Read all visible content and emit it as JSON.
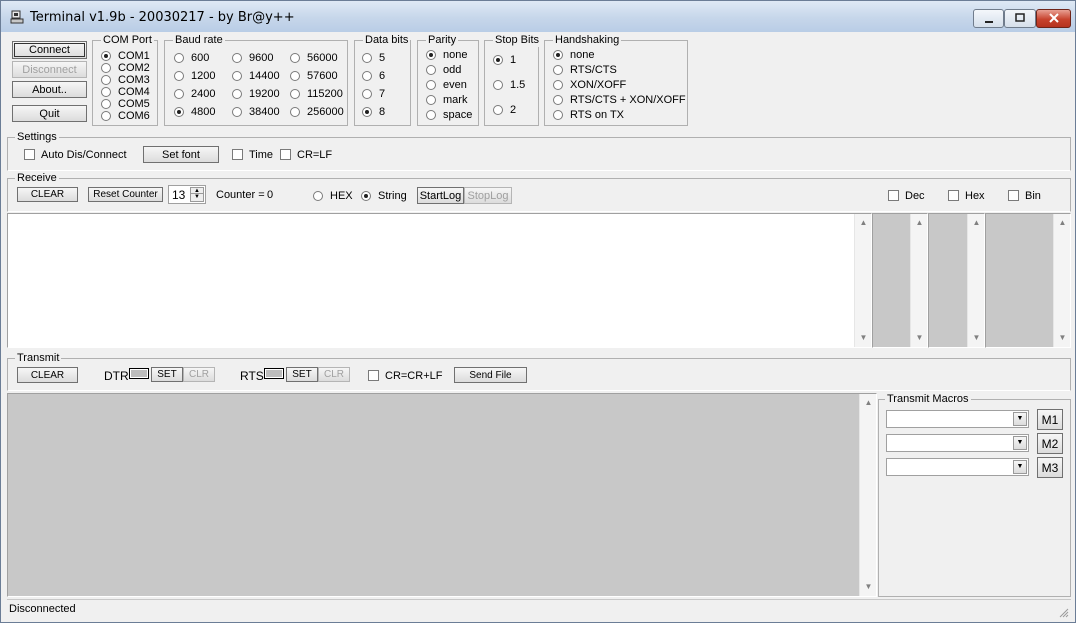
{
  "window": {
    "title": "Terminal v1.9b - 20030217 - by Br@y++"
  },
  "main_buttons": {
    "connect": "Connect",
    "disconnect": "Disconnect",
    "about": "About..",
    "quit": "Quit"
  },
  "com_port": {
    "title": "COM Port",
    "options": [
      "COM1",
      "COM2",
      "COM3",
      "COM4",
      "COM5",
      "COM6"
    ],
    "selected": "COM1"
  },
  "baud_rate": {
    "title": "Baud rate",
    "options": [
      "600",
      "1200",
      "2400",
      "4800",
      "9600",
      "14400",
      "19200",
      "38400",
      "56000",
      "57600",
      "115200",
      "256000"
    ],
    "selected": "4800"
  },
  "data_bits": {
    "title": "Data bits",
    "options": [
      "5",
      "6",
      "7",
      "8"
    ],
    "selected": "8"
  },
  "parity": {
    "title": "Parity",
    "options": [
      "none",
      "odd",
      "even",
      "mark",
      "space"
    ],
    "selected": "none"
  },
  "stop_bits": {
    "title": "Stop Bits",
    "options": [
      "1",
      "1.5",
      "2"
    ],
    "selected": "1"
  },
  "handshaking": {
    "title": "Handshaking",
    "options": [
      "none",
      "RTS/CTS",
      "XON/XOFF",
      "RTS/CTS + XON/XOFF",
      "RTS on TX"
    ],
    "selected": "none"
  },
  "settings": {
    "title": "Settings",
    "auto_dis_connect": "Auto Dis/Connect",
    "set_font": "Set font",
    "time": "Time",
    "cr_lf": "CR=LF"
  },
  "receive": {
    "title": "Receive",
    "clear": "CLEAR",
    "reset_counter": "Reset Counter",
    "counter_spin_value": "13",
    "counter_label": "Counter =",
    "counter_value": "0",
    "hex": "HEX",
    "string": "String",
    "mode_selected": "String",
    "start_log": "StartLog",
    "stop_log": "StopLog",
    "dec": "Dec",
    "hex_check": "Hex",
    "bin": "Bin"
  },
  "transmit": {
    "title": "Transmit",
    "clear": "CLEAR",
    "dtr": "DTR",
    "rts": "RTS",
    "set": "SET",
    "clr": "CLR",
    "cr_crlf": "CR=CR+LF",
    "send_file": "Send File"
  },
  "macros": {
    "title": "Transmit Macros",
    "buttons": [
      "M1",
      "M2",
      "M3"
    ]
  },
  "status": {
    "text": "Disconnected"
  },
  "colors": {
    "window_bg": "#f0f0f0",
    "text_area_bg": "#c8c8c8",
    "close_button": "#c7432e"
  }
}
